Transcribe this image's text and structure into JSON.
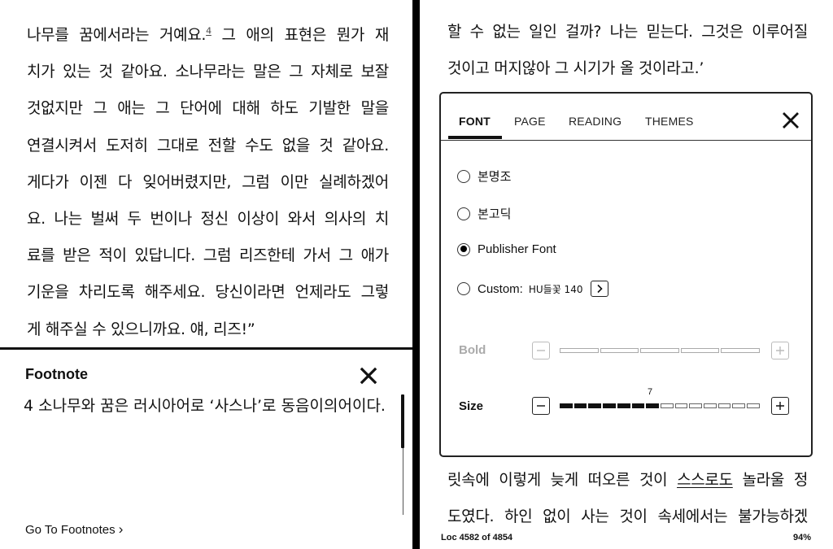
{
  "left_page": {
    "lines": [
      "나무를 꿈에서라는 거예요.",
      "치가 있는 것 같아요. 소나무라는 말은 그 자체로 보잘",
      "것없지만 그 애는 그 단어에 대해 하도 기발한 말을",
      "연결시켜서 도저히 그대로 전할 수도 없을 것 같아요.",
      "게다가 이젠 다 잊어버렸지만, 그럼 이만 실례하겠어",
      "요. 나는 벌써 두 번이나 정신 이상이 와서 의사의 치",
      "료를 받은 적이 있답니다. 그럼 리즈한테 가서 그 애가",
      "기운을 차리도록 해주세요. 당신이라면 언제라도 그렇",
      "게 해주실 수 있으니까요. 얘, 리즈!”"
    ],
    "first_line_after_ref": " 그 애의 표현은 뭔가 재",
    "footnote_ref": "4"
  },
  "footnote": {
    "title": "Footnote",
    "body": "4 소나무와 꿈은 러시아어로 ‘사스나’로 동음이의어이다.",
    "go_to_label": "Go To Footnotes",
    "go_to_chevron": "›"
  },
  "right_page": {
    "top_lines": [
      "할 수 없는 일인 걸까? 나는 믿는다. 그것은 이루어질",
      "것이고 머지않아 그 시기가 올 것이라고.’"
    ],
    "bottom_line_1_before": "릿속에 이렇게 늦게 떠오른 것이 ",
    "bottom_line_1_underlined": "스스로도",
    "bottom_line_1_after": " 놀라울 정",
    "bottom_line_2": "도였다. 하인 없이 사는 것이 속세에서는 불가능하겠",
    "status_location": "Loc 4582 of 4854",
    "status_percent": "94%"
  },
  "aa_panel": {
    "tabs": [
      {
        "label": "FONT",
        "active": true
      },
      {
        "label": "PAGE",
        "active": false
      },
      {
        "label": "READING",
        "active": false
      },
      {
        "label": "THEMES",
        "active": false
      }
    ],
    "fonts": [
      {
        "label": "본명조",
        "checked": false
      },
      {
        "label": "본고딕",
        "checked": false
      },
      {
        "label": "Publisher Font",
        "checked": true
      },
      {
        "label": "Custom:",
        "checked": false,
        "custom_font_name": "HU들꽃 140"
      }
    ],
    "bold": {
      "label": "Bold",
      "value": 0,
      "max": 5,
      "enabled": false
    },
    "size": {
      "label": "Size",
      "value": 7,
      "max": 14,
      "value_label": "7"
    }
  }
}
